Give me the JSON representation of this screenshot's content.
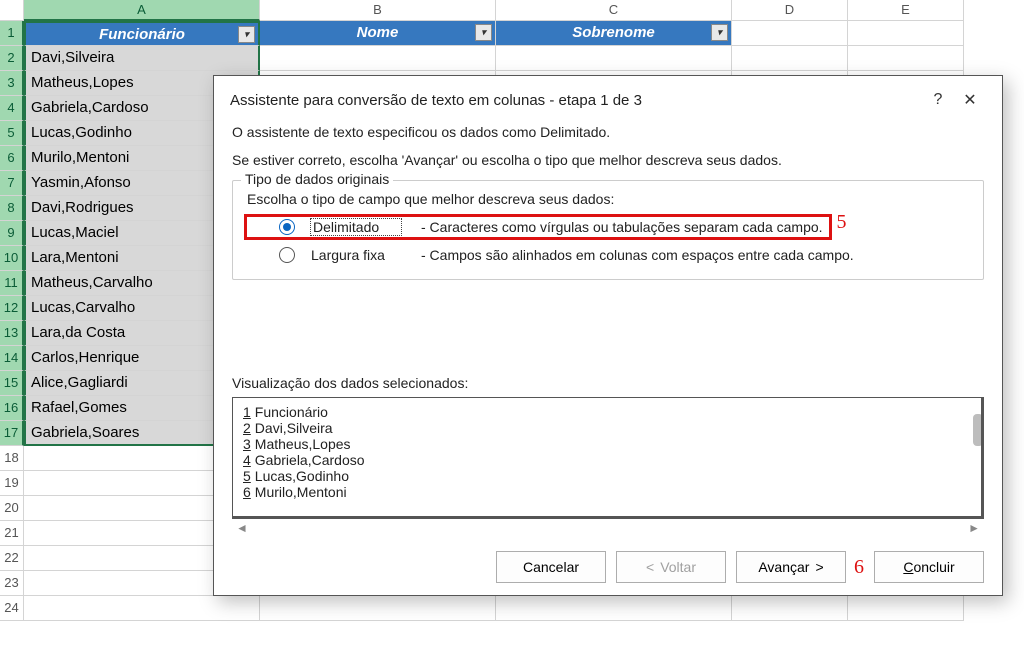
{
  "columns": {
    "A": "A",
    "B": "B",
    "C": "C",
    "D": "D",
    "E": "E"
  },
  "headers": {
    "funcionario": "Funcionário",
    "nome": "Nome",
    "sobrenome": "Sobrenome"
  },
  "rows": [
    "Davi,Silveira",
    "Matheus,Lopes",
    "Gabriela,Cardoso",
    "Lucas,Godinho",
    "Murilo,Mentoni",
    "Yasmin,Afonso",
    "Davi,Rodrigues",
    "Lucas,Maciel",
    "Lara,Mentoni",
    "Matheus,Carvalho",
    "Lucas,Carvalho",
    "Lara,da Costa",
    "Carlos,Henrique",
    "Alice,Gagliardi",
    "Rafael,Gomes",
    "Gabriela,Soares"
  ],
  "row_numbers": [
    "1",
    "2",
    "3",
    "4",
    "5",
    "6",
    "7",
    "8",
    "9",
    "10",
    "11",
    "12",
    "13",
    "14",
    "15",
    "16",
    "17",
    "18",
    "19",
    "20",
    "21",
    "22",
    "23",
    "24"
  ],
  "dialog": {
    "title": "Assistente para conversão de texto em colunas - etapa 1 de 3",
    "help": "?",
    "intro1": "O assistente de texto especificou os dados como Delimitado.",
    "intro2": "Se estiver correto, escolha 'Avançar' ou escolha o tipo que melhor descreva seus dados.",
    "fs_legend": "Tipo de dados originais",
    "choose": "Escolha o tipo de campo que melhor descreva seus dados:",
    "opt1": {
      "label": "Delimitado",
      "desc": "- Caracteres como vírgulas ou tabulações separam cada campo."
    },
    "opt2": {
      "label": "Largura fixa",
      "desc": "- Campos são alinhados em colunas com espaços entre cada campo."
    },
    "preview_label": "Visualização dos dados selecionados:",
    "preview": [
      {
        "n": "1",
        "t": "Funcionário"
      },
      {
        "n": "2",
        "t": "Davi,Silveira"
      },
      {
        "n": "3",
        "t": "Matheus,Lopes"
      },
      {
        "n": "4",
        "t": "Gabriela,Cardoso"
      },
      {
        "n": "5",
        "t": "Lucas,Godinho"
      },
      {
        "n": "6",
        "t": "Murilo,Mentoni"
      }
    ],
    "buttons": {
      "cancel": "Cancelar",
      "back_lt": "<",
      "back": "Voltar",
      "next": "Avançar",
      "next_gt": ">",
      "finish_u": "C",
      "finish": "oncluir"
    }
  },
  "annotations": {
    "five": "5",
    "six": "6"
  }
}
